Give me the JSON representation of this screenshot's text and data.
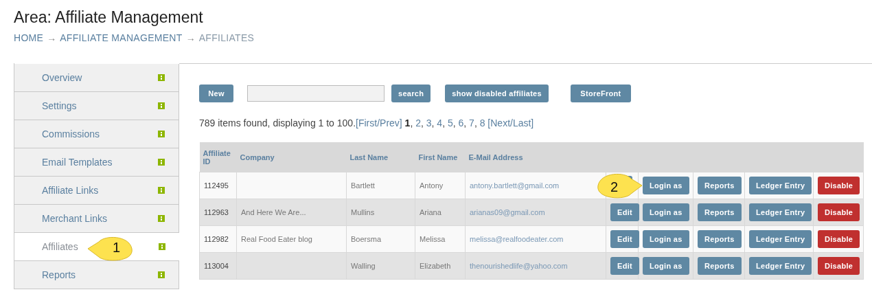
{
  "page": {
    "title": "Area: Affiliate Management",
    "breadcrumb": [
      {
        "label": "HOME",
        "current": false
      },
      {
        "label": "AFFILIATE MANAGEMENT",
        "current": false
      },
      {
        "label": "AFFILIATES",
        "current": true
      }
    ],
    "separator": "→"
  },
  "sidebar": {
    "items": [
      {
        "label": "Overview",
        "selected": false
      },
      {
        "label": "Settings",
        "selected": false
      },
      {
        "label": "Commissions",
        "selected": false
      },
      {
        "label": "Email Templates",
        "selected": false
      },
      {
        "label": "Affiliate Links",
        "selected": false
      },
      {
        "label": "Merchant Links",
        "selected": false
      },
      {
        "label": "Affiliates",
        "selected": true
      },
      {
        "label": "Reports",
        "selected": false
      }
    ]
  },
  "toolbar": {
    "new_button": "New",
    "search_button": "search",
    "disabled_button": "show disabled affiliates",
    "storefront_button": "StoreFront"
  },
  "pagination": {
    "summary": "789 items found, displaying 1 to 100.",
    "first_prev": "[First/Prev]",
    "pages": [
      {
        "label": "1",
        "selected": true
      },
      {
        "label": "2",
        "selected": false
      },
      {
        "label": "3",
        "selected": false
      },
      {
        "label": "4",
        "selected": false
      },
      {
        "label": "5",
        "selected": false
      },
      {
        "label": "6",
        "selected": false
      },
      {
        "label": "7",
        "selected": false
      },
      {
        "label": "8",
        "selected": false
      }
    ],
    "next_last": "[Next/Last]",
    "separator": ","
  },
  "table": {
    "columns": [
      "Affiliate ID",
      "Company",
      "Last Name",
      "First Name",
      "E-Mail Address"
    ],
    "rows": [
      {
        "id": "112495",
        "company": "",
        "last_name": "Bartlett",
        "first_name": "Antony",
        "email": "antony.bartlett@gmail.com",
        "actions": [
          {
            "kind": "edit"
          },
          {
            "kind": "primary",
            "label": "Login as"
          },
          {
            "kind": "primary",
            "label": "Reports"
          },
          {
            "kind": "primary",
            "label": "Ledger Entry"
          },
          {
            "kind": "danger",
            "label": "Disable"
          }
        ]
      },
      {
        "id": "112963",
        "company": "And Here We Are...",
        "last_name": "Mullins",
        "first_name": "Ariana",
        "email": "arianas09@gmail.com",
        "actions": [
          {
            "kind": "edit",
            "label": "Edit"
          },
          {
            "kind": "primary",
            "label": "Login as"
          },
          {
            "kind": "primary",
            "label": "Reports"
          },
          {
            "kind": "primary",
            "label": "Ledger Entry"
          },
          {
            "kind": "danger",
            "label": "Disable"
          }
        ]
      },
      {
        "id": "112982",
        "company": "Real Food Eater blog",
        "last_name": "Boersma",
        "first_name": "Melissa",
        "email": "melissa@realfoodeater.com",
        "actions": [
          {
            "kind": "edit",
            "label": "Edit"
          },
          {
            "kind": "primary",
            "label": "Login as"
          },
          {
            "kind": "primary",
            "label": "Reports"
          },
          {
            "kind": "primary",
            "label": "Ledger Entry"
          },
          {
            "kind": "danger",
            "label": "Disable"
          }
        ]
      },
      {
        "id": "113004",
        "company": "",
        "last_name": "Walling",
        "first_name": "Elizabeth",
        "email": "thenourishedlife@yahoo.com",
        "actions": [
          {
            "kind": "edit",
            "label": "Edit"
          },
          {
            "kind": "primary",
            "label": "Login as"
          },
          {
            "kind": "primary",
            "label": "Reports"
          },
          {
            "kind": "primary",
            "label": "Ledger Entry"
          },
          {
            "kind": "danger",
            "label": "Disable"
          }
        ]
      }
    ]
  },
  "callouts": [
    {
      "number": "1",
      "kind": "left"
    },
    {
      "number": "2",
      "kind": "right"
    }
  ]
}
